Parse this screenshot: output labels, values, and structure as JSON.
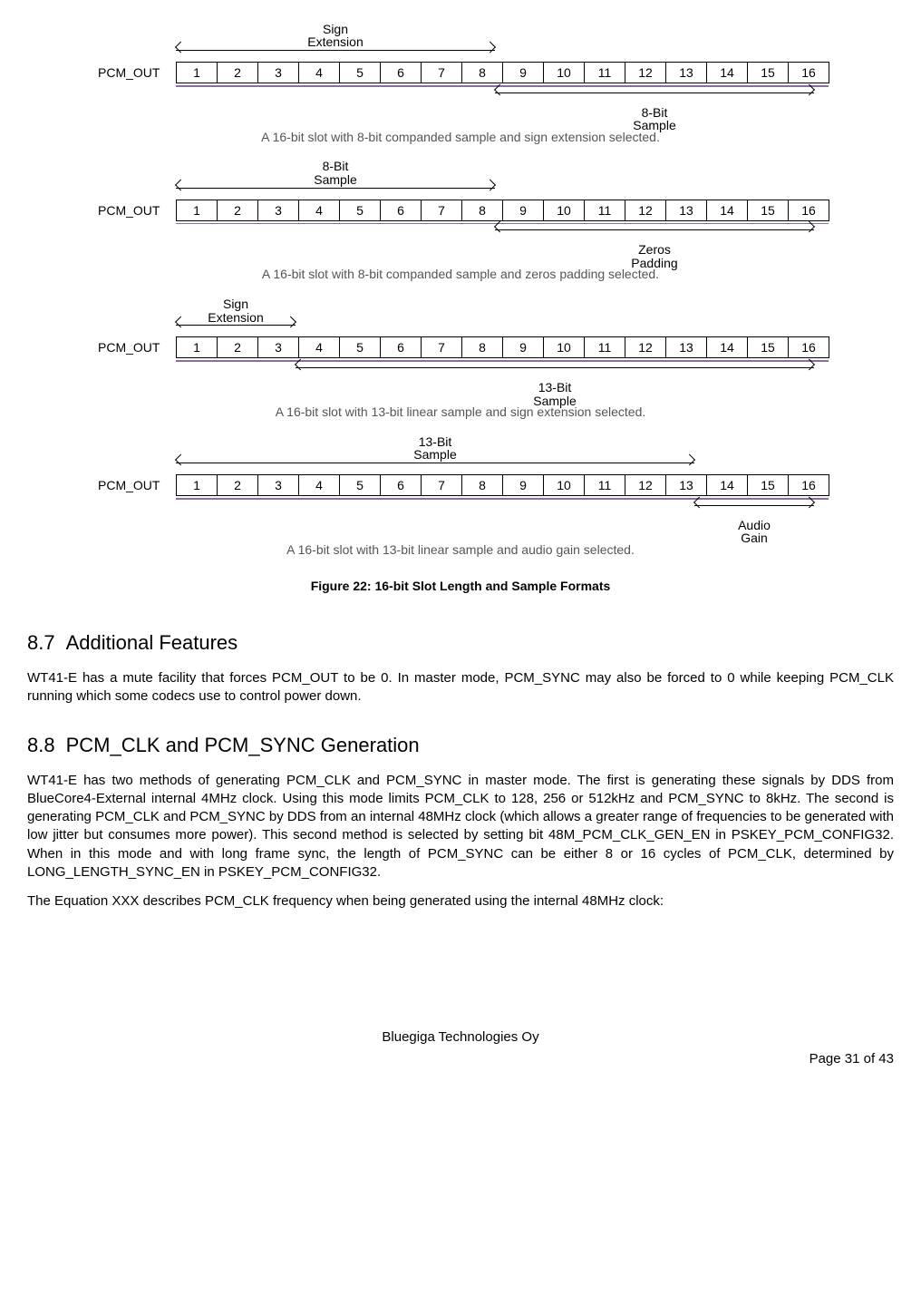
{
  "slots": [
    "1",
    "2",
    "3",
    "4",
    "5",
    "6",
    "7",
    "8",
    "9",
    "10",
    "11",
    "12",
    "13",
    "14",
    "15",
    "16"
  ],
  "pcm_out": "PCM_OUT",
  "d1": {
    "top_label": "Sign\nExtension",
    "bottom_label": "8-Bit\nSample",
    "caption": "A 16-bit slot with 8-bit companded sample and sign extension selected."
  },
  "d2": {
    "top_label": "8-Bit\nSample",
    "bottom_label": "Zeros\nPadding",
    "caption": "A 16-bit slot with 8-bit companded sample and zeros padding selected."
  },
  "d3": {
    "top_label": "Sign\nExtension",
    "bottom_label": "13-Bit\nSample",
    "caption": "A 16-bit slot with 13-bit linear sample and sign extension selected."
  },
  "d4": {
    "top_label": "13-Bit\nSample",
    "bottom_label": "Audio\nGain",
    "caption": "A 16-bit slot with 13-bit linear sample and audio gain selected."
  },
  "figure_title": "Figure 22: 16-bit Slot Length and Sample Formats",
  "s87": {
    "num": "8.7",
    "title": "Additional Features",
    "p1": "WT41-E has a mute facility that forces PCM_OUT to be 0. In master mode, PCM_SYNC may also be forced to 0 while keeping PCM_CLK running which some codecs use to control power down."
  },
  "s88": {
    "num": "8.8",
    "title": "PCM_CLK and PCM_SYNC Generation",
    "p1": "WT41-E has two methods of generating PCM_CLK and PCM_SYNC in master mode. The first is generating these signals by DDS from BlueCore4-External internal 4MHz clock. Using this mode limits PCM_CLK to 128, 256 or 512kHz and PCM_SYNC to 8kHz. The second is generating PCM_CLK and PCM_SYNC by DDS from an internal 48MHz clock (which allows a greater range of frequencies to be generated with low jitter but consumes more power). This second method is selected by setting bit 48M_PCM_CLK_GEN_EN in PSKEY_PCM_CONFIG32. When in this mode and with long frame sync, the length of PCM_SYNC can be either 8 or 16 cycles of PCM_CLK, determined by LONG_LENGTH_SYNC_EN in PSKEY_PCM_CONFIG32.",
    "p2": "The Equation XXX describes PCM_CLK frequency when being generated using the internal 48MHz clock:"
  },
  "footer": "Bluegiga Technologies Oy",
  "page": "Page 31 of 43"
}
